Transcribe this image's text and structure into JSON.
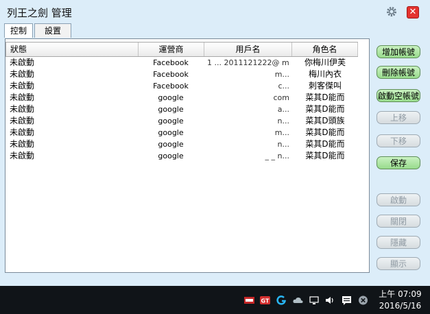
{
  "window": {
    "title": "列王之劍 管理"
  },
  "tabs": [
    {
      "label": "控制"
    },
    {
      "label": "設置"
    }
  ],
  "table": {
    "columns": [
      "狀態",
      "運營商",
      "用戶名",
      "角色名"
    ],
    "rows": [
      {
        "status": "未啟動",
        "operator": "Facebook",
        "username": "1 ... 2011121222@ m...",
        "role": "你梅川伊芙"
      },
      {
        "status": "未啟動",
        "operator": "Facebook",
        "username": "m...",
        "role": "梅川內衣"
      },
      {
        "status": "未啟動",
        "operator": "Facebook",
        "username": "c...",
        "role": "刺客傑叫"
      },
      {
        "status": "未啟動",
        "operator": "google",
        "username": "com",
        "role": "菜其D能而"
      },
      {
        "status": "未啟動",
        "operator": "google",
        "username": "a...",
        "role": "菜其D能而"
      },
      {
        "status": "未啟動",
        "operator": "google",
        "username": "n...",
        "role": "菜其D頭族"
      },
      {
        "status": "未啟動",
        "operator": "google",
        "username": "m...",
        "role": "菜其D能而"
      },
      {
        "status": "未啟動",
        "operator": "google",
        "username": "n...",
        "role": "菜其D能而"
      },
      {
        "status": "未啟動",
        "operator": "google",
        "username": "_ _ n...",
        "role": "菜其D能而"
      }
    ]
  },
  "buttons": [
    {
      "label": "增加帳號",
      "enabled": true
    },
    {
      "label": "刪除帳號",
      "enabled": true
    },
    {
      "label": "啟動空帳號",
      "enabled": true
    },
    {
      "label": "上移",
      "enabled": false
    },
    {
      "label": "下移",
      "enabled": false
    },
    {
      "label": "保存",
      "enabled": true
    },
    {
      "label": "啟動",
      "enabled": false
    },
    {
      "label": "關閉",
      "enabled": false
    },
    {
      "label": "隱藏",
      "enabled": false
    },
    {
      "label": "顯示",
      "enabled": false
    }
  ],
  "taskbar": {
    "time": "上午 07:09",
    "date": "2016/5/16",
    "tray_icons": [
      "app-tray-icon",
      "gpu-tray-icon",
      "logitech-g-icon",
      "cloud-icon",
      "network-icon",
      "volume-icon",
      "message-icon",
      "close-circle-icon"
    ]
  },
  "colors": {
    "window_bg": "#dcedf9",
    "enabled_button": "#a8e29d",
    "disabled_button": "#dde2e5",
    "close_button": "#e4332e",
    "taskbar": "#101418"
  }
}
